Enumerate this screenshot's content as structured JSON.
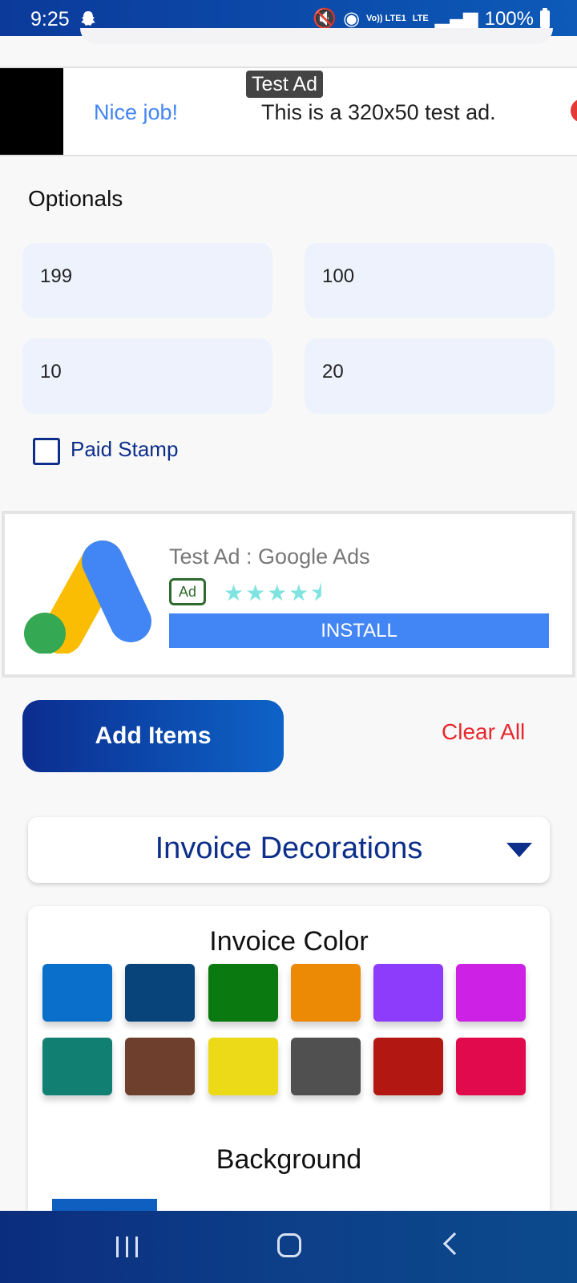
{
  "status_bar": {
    "time": "9:25",
    "network": "LTE",
    "volte": "Vo)) LTE1",
    "battery": "100%"
  },
  "banner_ad": {
    "label": "Test Ad",
    "headline": "Nice job!",
    "text": "This is a 320x50 test ad."
  },
  "optionals": {
    "title": "Optionals",
    "fields": [
      "199",
      "100",
      "10",
      "20"
    ],
    "paid_stamp_label": "Paid Stamp",
    "paid_stamp_checked": false
  },
  "native_ad": {
    "title": "Test Ad : Google Ads",
    "badge": "Ad",
    "rating": 4.5,
    "stars": "★★★★⯨",
    "install_label": "INSTALL"
  },
  "actions": {
    "add_items_label": "Add Items",
    "clear_all_label": "Clear All"
  },
  "decorations": {
    "title": "Invoice Decorations"
  },
  "invoice_color": {
    "title": "Invoice Color",
    "swatches": [
      "#0a6fcb",
      "#08437a",
      "#0a7a10",
      "#ec8a06",
      "#8c3cfa",
      "#cd22e6",
      "#127f73",
      "#6f3f2e",
      "#ecd918",
      "#505050",
      "#b31712",
      "#e10a4c"
    ]
  },
  "background": {
    "title": "Background",
    "first_swatch": "#0e5fc0"
  }
}
